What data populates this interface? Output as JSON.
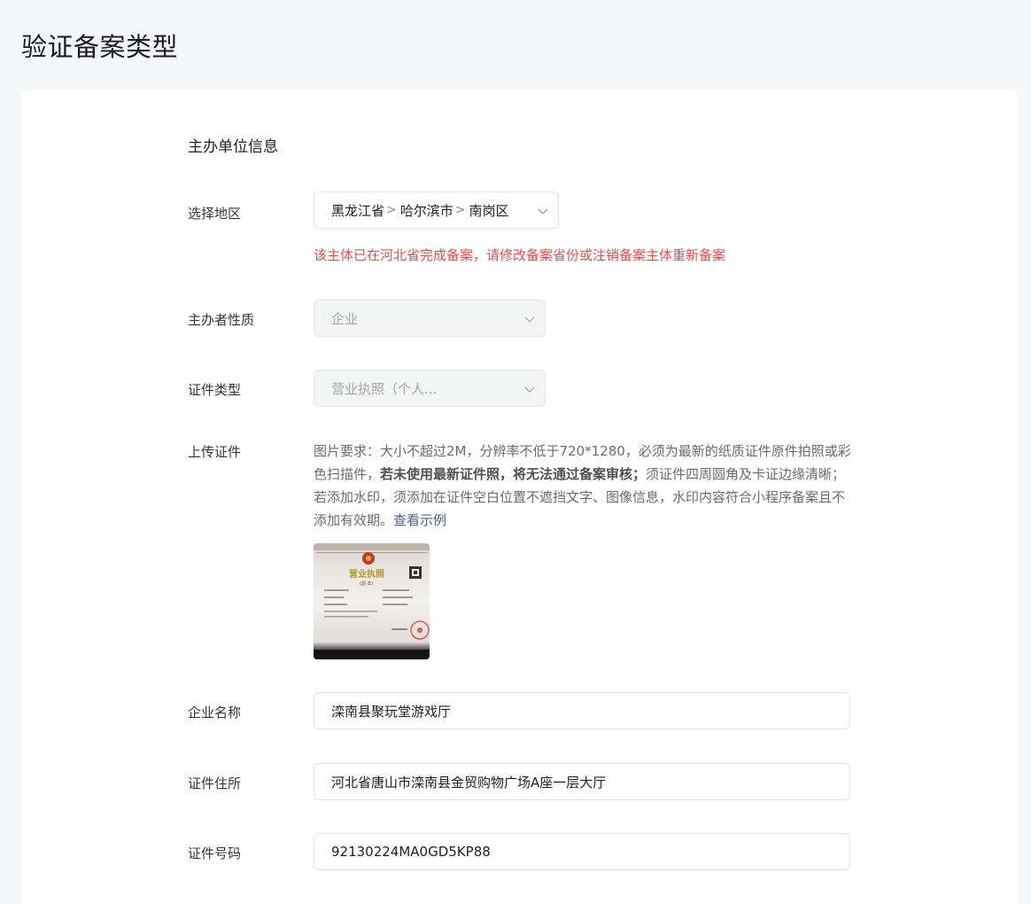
{
  "page_title": "验证备案类型",
  "section_title": "主办单位信息",
  "region": {
    "label": "选择地区",
    "province": "黑龙江省",
    "city": "哈尔滨市",
    "district": "南岗区",
    "separator": ">",
    "error": "该主体已在河北省完成备案，请修改备案省份或注销备案主体重新备案"
  },
  "organizer_type": {
    "label": "主办者性质",
    "value": "企业"
  },
  "cert_type": {
    "label": "证件类型",
    "value": "营业执照（个人..."
  },
  "upload": {
    "label": "上传证件",
    "desc_part1": "图片要求：大小不超过2M，分辨率不低于720*1280，必须为最新的纸质证件原件拍照或彩色扫描件，",
    "desc_bold": "若未使用最新证件照，将无法通过备案审核；",
    "desc_part2": "须证件四周圆角及卡证边缘清晰；若添加水印，须添加在证件空白位置不遮挡文字、图像信息，水印内容符合小程序备案且不添加有效期。",
    "example_link": "查看示例",
    "thumbnail_title": "营业执照",
    "thumbnail_subtitle": "(副 本)"
  },
  "company_name": {
    "label": "企业名称",
    "value": "滦南县聚玩堂游戏厅"
  },
  "cert_address": {
    "label": "证件住所",
    "value": "河北省唐山市滦南县金贸购物广场A座一层大厅"
  },
  "cert_number": {
    "label": "证件号码",
    "value": "92130224MA0GD5KP88"
  },
  "colors": {
    "error": "#e34d4d",
    "link": "#4d5f8a",
    "background": "#f6f7f9"
  }
}
